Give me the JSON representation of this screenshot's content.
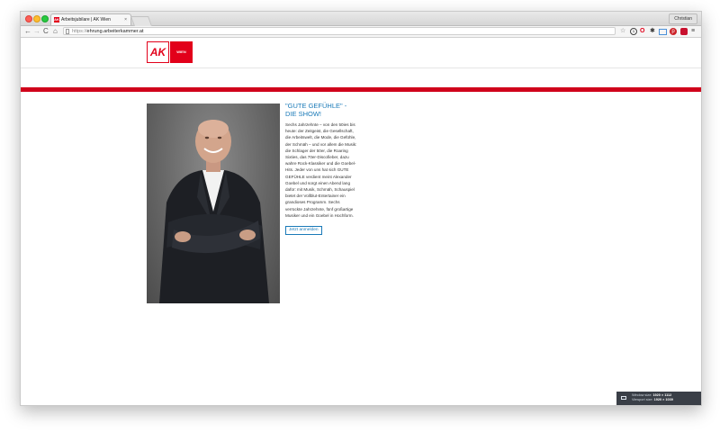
{
  "browser": {
    "tab_title": "Arbeitsjubilare | AK Wien",
    "tab_close": "×",
    "profile_name": "Christian",
    "url_proto": "https://",
    "url_host": "ehrung.arbeiterkammer.at",
    "nav": {
      "back": "←",
      "forward": "→",
      "reload": "C",
      "home": "⌂"
    },
    "toolbar_icons": [
      "star-icon",
      "info-icon",
      "opera-icon",
      "gear-icon",
      "bookmark-icon",
      "pinterest-icon",
      "adblock-icon",
      "menu-icon"
    ]
  },
  "site": {
    "logo_ak": "AK",
    "logo_wien": "WIEN",
    "brand_color": "#e2001a"
  },
  "article": {
    "headline": "\"GUTE GEFÜHLE\" - DIE SHOW!",
    "body": "Sechs Jahrzehnte – von den 50ies bis heute: der Zeitgeist, die Gesellschaft, die Arbeitswelt, die Mode, die Gefühle, der Schmäh – und vor allem die Musik: die Schlager der 50er, die Roaring Sixties, das 70er-Discofieber, dazu wahre Rock-Klassiker und die Goebel-Hits. Jeder von uns hat sich GUTE GEFÜHLE verdient meint Alexander Goebel und sorgt einen Abend lang dafür: mit Musik, Schmäh, Schauspiel bietet der Vollblut-Entertainer ein grandioses Programm. Sechs verrückte Jahrzehnte, fünf großartige Musiker und ein Goebel in Hochform.",
    "cta_label": "Jetzt anmelden",
    "accent_color": "#1a7ab8"
  },
  "overlay": {
    "window_label": "Window size:",
    "window_value": "1920 × 1112",
    "viewport_label": "Viewport size:",
    "viewport_value": "1920 × 1039"
  }
}
